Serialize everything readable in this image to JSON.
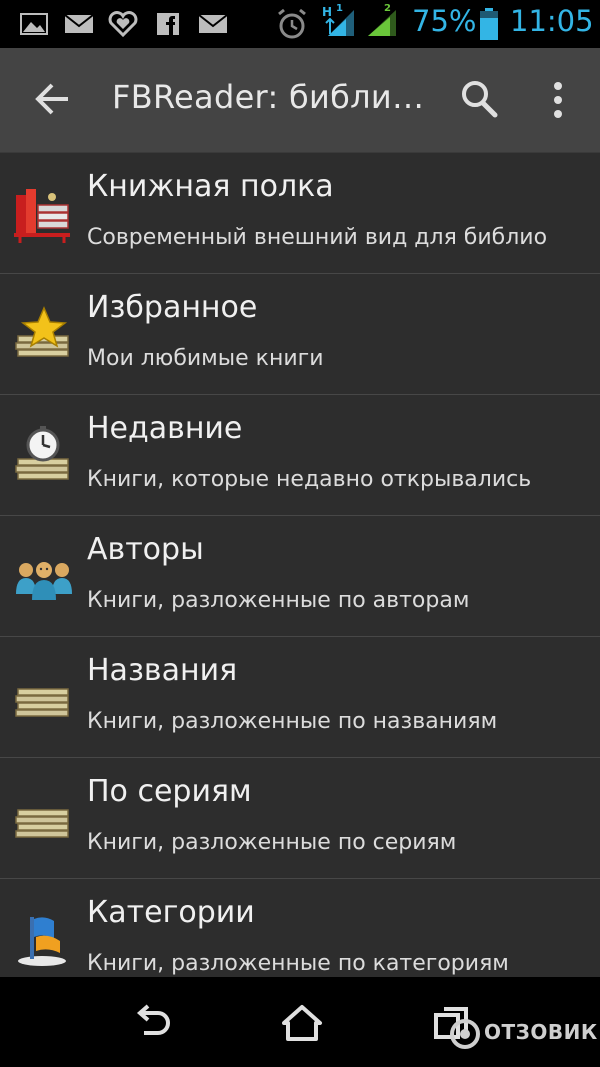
{
  "status_bar": {
    "battery": "75%",
    "time": "11:05",
    "network_h": "H",
    "sim1": "1",
    "sim2": "2",
    "colors": {
      "accent": "#33b5e5",
      "signal2": "#6ac63a"
    }
  },
  "action_bar": {
    "title": "FBReader: библи…",
    "icons": {
      "back": "arrow-left-icon",
      "search": "search-icon",
      "menu": "overflow-menu-icon"
    }
  },
  "library": {
    "items": [
      {
        "title": "Книжная полка",
        "subtitle": "Современный внешний вид для библио",
        "icon": "bookshelf-icon"
      },
      {
        "title": "Избранное",
        "subtitle": "Мои любимые книги",
        "icon": "favorites-star-icon"
      },
      {
        "title": "Недавние",
        "subtitle": "Книги, которые недавно открывались",
        "icon": "recent-clock-icon"
      },
      {
        "title": "Авторы",
        "subtitle": "Книги, разложенные по авторам",
        "icon": "authors-people-icon"
      },
      {
        "title": "Названия",
        "subtitle": "Книги, разложенные по названиям",
        "icon": "titles-books-icon"
      },
      {
        "title": "По сериям",
        "subtitle": "Книги, разложенные по сериям",
        "icon": "series-books-icon"
      },
      {
        "title": "Категории",
        "subtitle": "Книги, разложенные по категориям",
        "icon": "categories-flag-icon"
      }
    ]
  },
  "nav_bar": {
    "icons": {
      "back": "nav-back-icon",
      "home": "nav-home-icon",
      "recents": "nav-recents-icon"
    }
  },
  "watermark": {
    "text": "ОТЗОВИК"
  }
}
